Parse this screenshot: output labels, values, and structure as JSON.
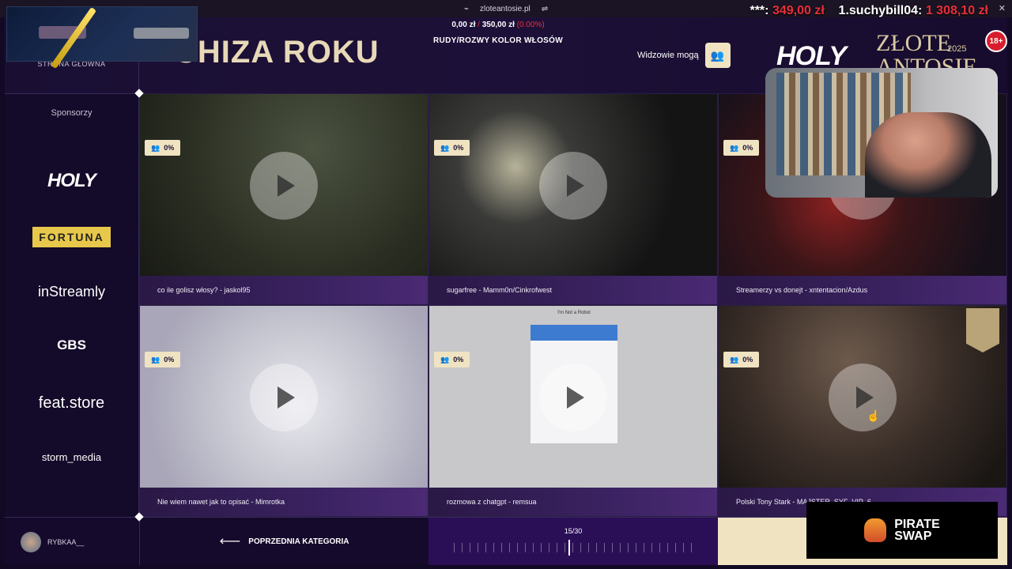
{
  "browser": {
    "url": "zloteantosie.pl"
  },
  "header": {
    "home_label": "STRONA GŁÓWNA",
    "page_title": "CHIZA ROKU",
    "stats": {
      "a": "0,00 zł",
      "sep": "/",
      "b": "350,00 zł",
      "pct": "(0.00%)"
    },
    "category": "RUDY/ROZWY KOLOR WŁOSÓW",
    "viewers_label": "Widzowie mogą",
    "age": "18+",
    "brand_holy": "HOLY",
    "brand_event": "ZŁOTE ANTOSIE",
    "brand_year": "2025"
  },
  "donation": {
    "prefix": "***:",
    "prefix_amount": "349,00 zł",
    "leader": "1.suchybill04:",
    "leader_amount": "1 308,10 zł"
  },
  "sidebar": {
    "title": "Sponsorzy",
    "sponsors": [
      "HOLY",
      "FORTUNA",
      "inStreamly",
      "GBS",
      "feat.store",
      "storm_media"
    ]
  },
  "tiles": [
    {
      "percent": "0%",
      "caption": "co ile golisz włosy? - jaskol95"
    },
    {
      "percent": "0%",
      "caption": "sugarfree - Mamm0n/Cinkrofwest"
    },
    {
      "percent": "0%",
      "caption": "Streamerzy vs donejt - xntentacion/Azdus"
    },
    {
      "percent": "0%",
      "caption": "Nie wiem nawet jak to opisać - Mimrotka"
    },
    {
      "percent": "0%",
      "caption": "rozmowa z chatgpt - remsua"
    },
    {
      "percent": "0%",
      "caption": "Polski Tony Stark - MAJSTER_SYF_VIP_6"
    }
  ],
  "captcha": {
    "title": "I'm Not a Robot"
  },
  "bottom": {
    "username": "RYBKAA__",
    "prev_label": "POPRZEDNIA KATEGORIA",
    "counter": "15/30"
  },
  "pirate": {
    "line1": "PIRATE",
    "line2": "SWAP"
  },
  "colors": {
    "accent_gold": "#efe3c2",
    "danger": "#e8303a",
    "bg": "#120a24"
  }
}
